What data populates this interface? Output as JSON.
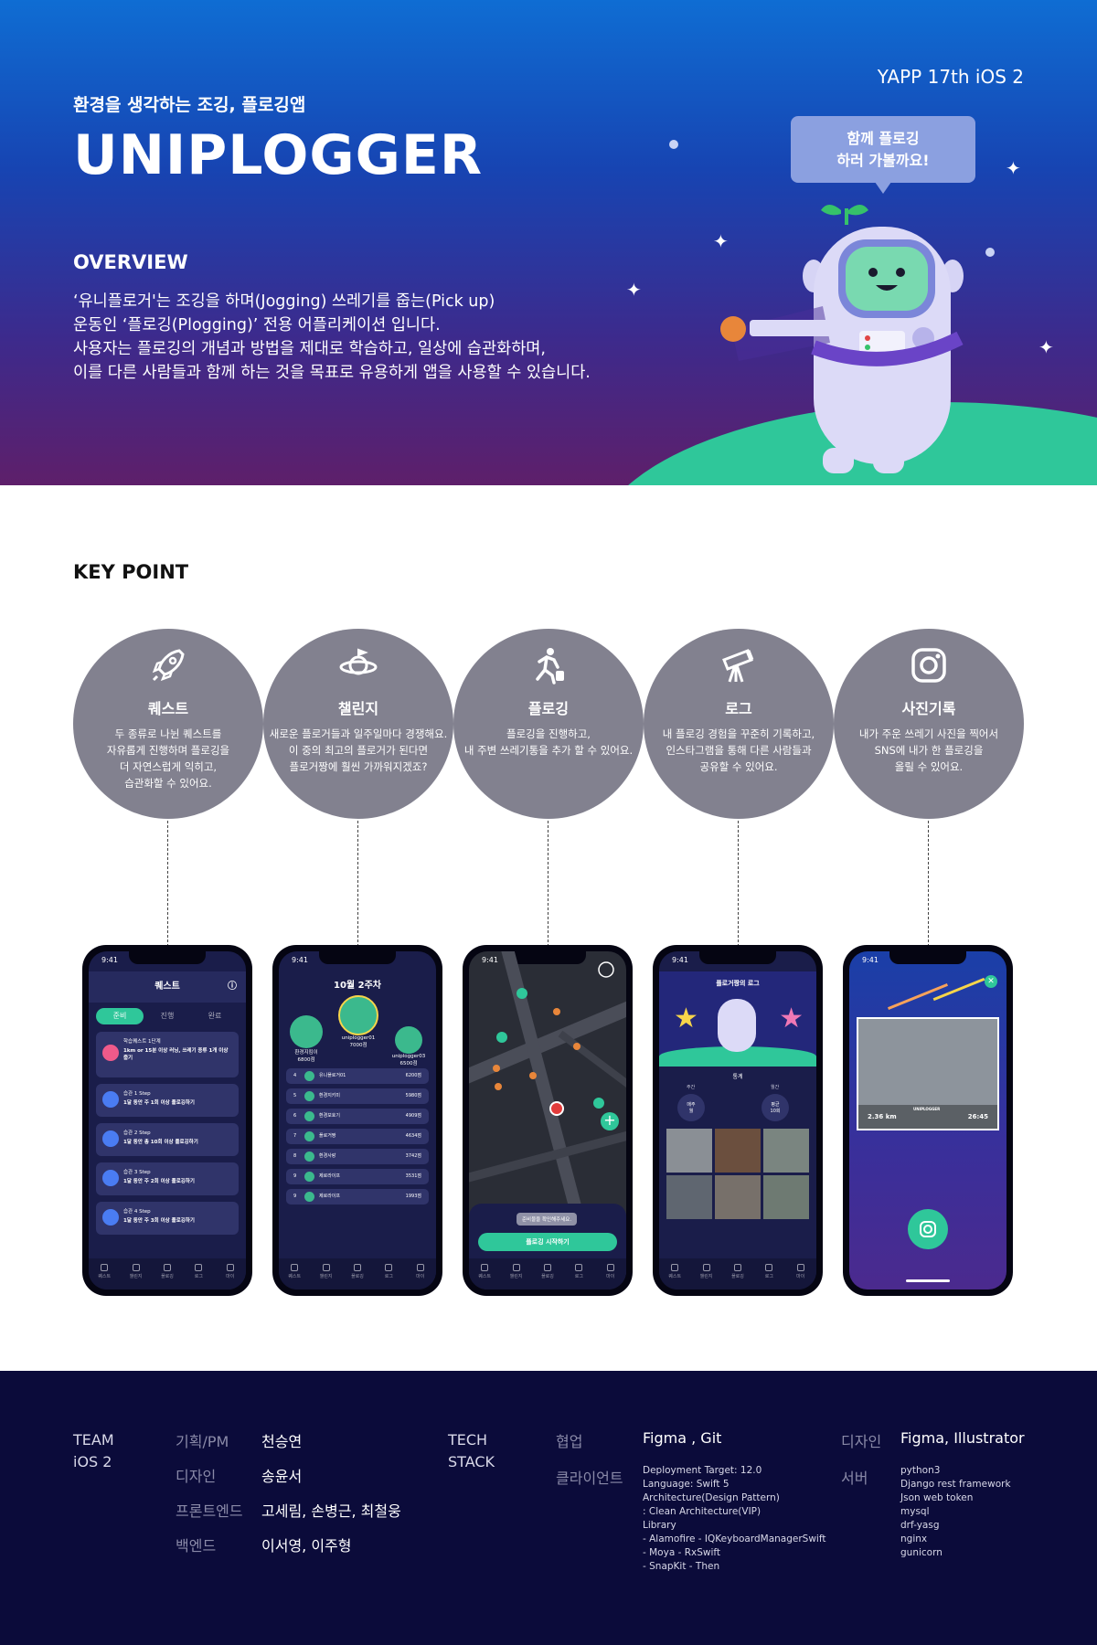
{
  "header": {
    "yapp_label": "YAPP 17th iOS 2",
    "subtitle": "환경을 생각하는 조깅, 플로깅앱",
    "logo_text": "UNIPLOGGER",
    "bubble_line1": "함께 플로깅",
    "bubble_line2": "하러 가볼까요!"
  },
  "overview": {
    "title": "OVERVIEW",
    "lines": [
      "‘유니플로거'는 조깅을 하며(Jogging) 쓰레기를 줍는(Pick up)",
      "운동인 ‘플로깅(Plogging)’ 전용 어플리케이션 입니다.",
      "사용자는 플로깅의 개념과 방법을 제대로 학습하고, 일상에 습관화하며,",
      "이를 다른 사람들과 함께 하는 것을 목표로 유용하게 앱을 사용할 수 있습니다."
    ]
  },
  "keypoint": {
    "title": "KEY POINT",
    "items": [
      {
        "icon": "rocket-icon",
        "title": "퀘스트",
        "desc": "두 종류로 나뉜 퀘스트를\n자유롭게 진행하며 플로깅을\n더 자연스럽게 익히고,\n습관화할 수 있어요."
      },
      {
        "icon": "planet-icon",
        "title": "챌린지",
        "desc": "새로운 플로거들과 일주일마다 경쟁해요.\n이 중의 최고의 플로거가 된다면\n플로거짱에 훨씬 가까워지겠죠?"
      },
      {
        "icon": "runner-icon",
        "title": "플로깅",
        "desc": "플로깅을 진행하고,\n내 주변 쓰레기통을 추가 할 수 있어요."
      },
      {
        "icon": "telescope-icon",
        "title": "로그",
        "desc": "내 플로깅 경험을 꾸준히 기록하고,\n인스타그램을 통해 다른 사람들과\n공유할 수 있어요."
      },
      {
        "icon": "instagram-icon",
        "title": "사진기록",
        "desc": "내가 주운 쓰레기 사진을 찍어서\nSNS에 내가 한 플로깅을\n올릴 수 있어요."
      }
    ]
  },
  "phones": {
    "time": "9:41",
    "quest": {
      "title": "퀘스트",
      "tabs": [
        "준비",
        "진행",
        "완료"
      ],
      "cards": [
        {
          "t": "학습퀘스트 1단계",
          "d": "1km or 15분 이상 러닝, 쓰레기 종류 1개 이상 줍기"
        },
        {
          "t": "습관 1 Step",
          "d": "1달 동안 주 1회 이상 플로깅하기"
        },
        {
          "t": "습관 2 Step",
          "d": "1달 동안 총 10회 이상 플로깅하기"
        },
        {
          "t": "습관 3 Step",
          "d": "1달 동안 주 2회 이상 플로깅하기"
        },
        {
          "t": "습관 4 Step",
          "d": "1달 동안 주 3회 이상 플로깅하기"
        }
      ]
    },
    "challenge": {
      "title": "10월 2주차",
      "podium": [
        {
          "name": "환경지킴이",
          "score": "6800점"
        },
        {
          "name": "uniplogger01",
          "score": "7000점"
        },
        {
          "name": "uniplogger03",
          "score": "6500점"
        }
      ],
      "rows": [
        {
          "rank": "4",
          "name": "유니플로거01",
          "score": "6200점"
        },
        {
          "rank": "5",
          "name": "환경지키미",
          "score": "5980점"
        },
        {
          "rank": "6",
          "name": "환경보호기",
          "score": "4909점"
        },
        {
          "rank": "7",
          "name": "플로거짱",
          "score": "4634점"
        },
        {
          "rank": "8",
          "name": "환경사랑",
          "score": "3742점"
        },
        {
          "rank": "9",
          "name": "제로라이프",
          "score": "3531점"
        },
        {
          "rank": "9",
          "name": "제로라이프",
          "score": "1993점"
        }
      ]
    },
    "plogging": {
      "toast": "준비물을 확인해주세요.",
      "start_button": "플로깅 시작하기"
    },
    "log": {
      "title": "플로거짱의 로그",
      "stats_title": "통계",
      "weekly_label": "주간",
      "monthly_label": "월간",
      "weekly_value": "매주\n월",
      "monthly_value": "평균\n10회"
    },
    "photo": {
      "distance": "2.36 km",
      "time": "26:45",
      "watermark": "UNIPLOGGER"
    },
    "tabbar": [
      "퀘스트",
      "챌린지",
      "플로깅",
      "로그",
      "마이"
    ]
  },
  "footer": {
    "team_label": "TEAM\niOS 2",
    "team": [
      {
        "role": "기획/PM",
        "name": "천승연"
      },
      {
        "role": "디자인",
        "name": "송윤서"
      },
      {
        "role": "프론트엔드",
        "name": "고세림,  손병근,  최철웅"
      },
      {
        "role": "백엔드",
        "name": "이서영,  이주형"
      }
    ],
    "tech_label": "TECH\nSTACK",
    "collab_label": "협업",
    "collab_value": "Figma ,  Git",
    "client_label": "클라이언트",
    "client_value": "Deployment Target: 12.0\nLanguage: Swift 5\nArchitecture(Design Pattern)\n: Clean Architecture(VIP)\nLibrary\n- Alamofire      - IQKeyboardManagerSwift\n- Moya           - RxSwift\n- SnapKit        - Then",
    "design_label": "디자인",
    "design_value": "Figma,  Illustrator",
    "server_label": "서버",
    "server_value": "python3\nDjango rest framework\nJson web token\nmysql\ndrf-yasg\nnginx\ngunicorn"
  },
  "colors": {
    "accent_green": "#2fc79a",
    "circle_gray": "#82818f",
    "footer_navy": "#0b0b3a"
  }
}
